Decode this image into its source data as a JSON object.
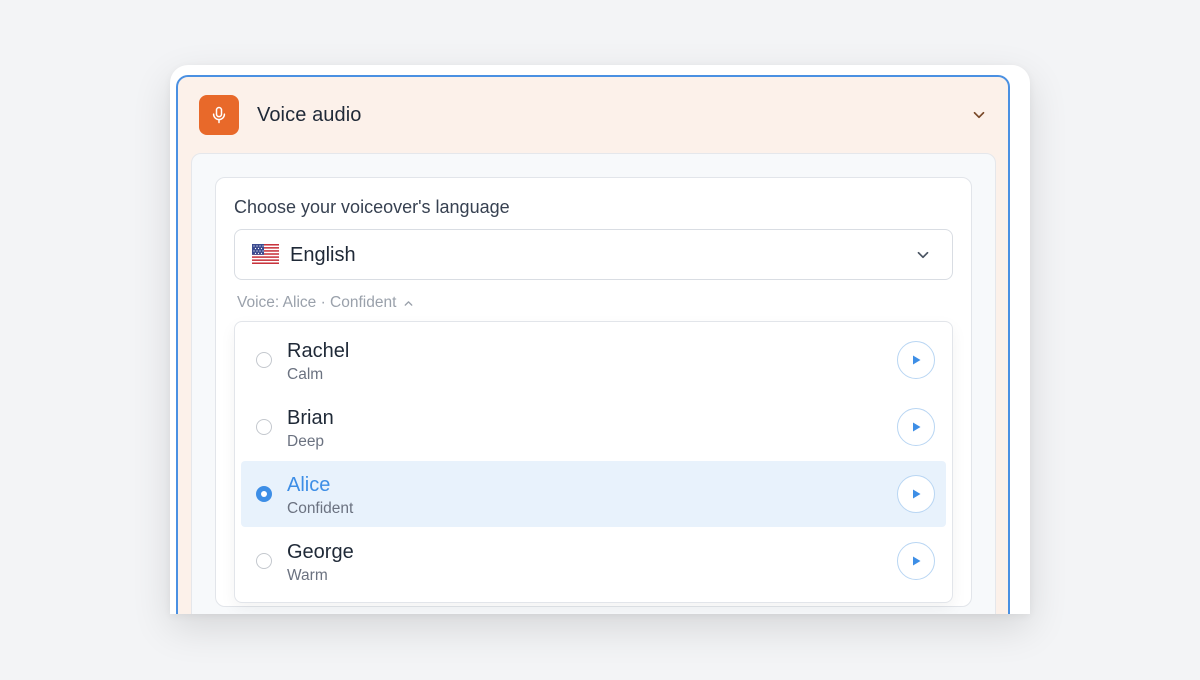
{
  "panel": {
    "title": "Voice audio",
    "icon": "microphone-icon",
    "accent_color": "#e8692a",
    "focus_border_color": "#4a90e2"
  },
  "language": {
    "label": "Choose your voiceover's language",
    "selected": "English",
    "flag": "us-flag-icon"
  },
  "voice_summary": {
    "text": "Voice: Alice · Confident",
    "expanded": true
  },
  "voices": [
    {
      "name": "Rachel",
      "style": "Calm",
      "selected": false
    },
    {
      "name": "Brian",
      "style": "Deep",
      "selected": false
    },
    {
      "name": "Alice",
      "style": "Confident",
      "selected": true
    },
    {
      "name": "George",
      "style": "Warm",
      "selected": false
    }
  ],
  "colors": {
    "selected_text": "#3d8ee6",
    "selected_row_bg": "#e8f2fc"
  }
}
